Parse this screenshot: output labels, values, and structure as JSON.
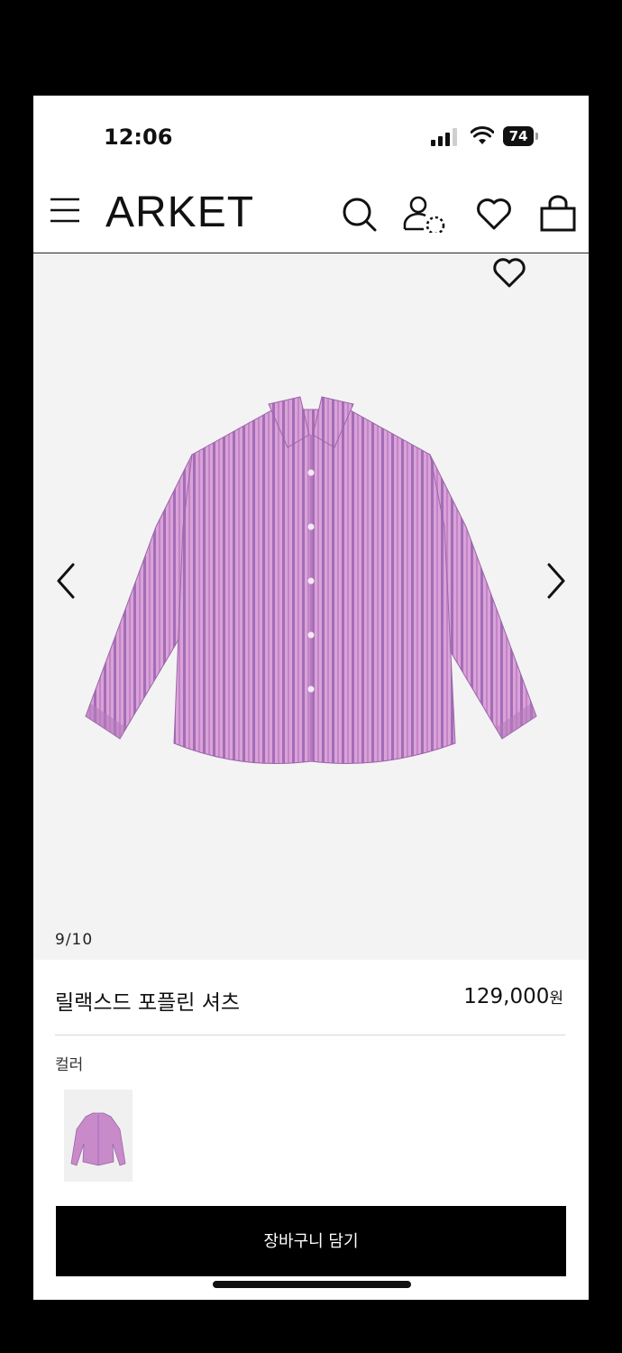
{
  "status_bar": {
    "time": "12:06",
    "battery": "74"
  },
  "header": {
    "logo": "ARKET",
    "icons": [
      "menu-icon",
      "search-icon",
      "account-icon",
      "wishlist-icon",
      "bag-icon"
    ]
  },
  "gallery": {
    "counter": "9/10",
    "image_index": 9,
    "image_total": 10,
    "stripe_colors": [
      "#c98bcc",
      "#a97fbf",
      "#e0b8df"
    ]
  },
  "product": {
    "name": "릴랙스드 포플린 셔츠",
    "price": "129,000",
    "currency": "원",
    "color_label": "컬러"
  },
  "cart": {
    "button_label": "장바구니 담기"
  }
}
